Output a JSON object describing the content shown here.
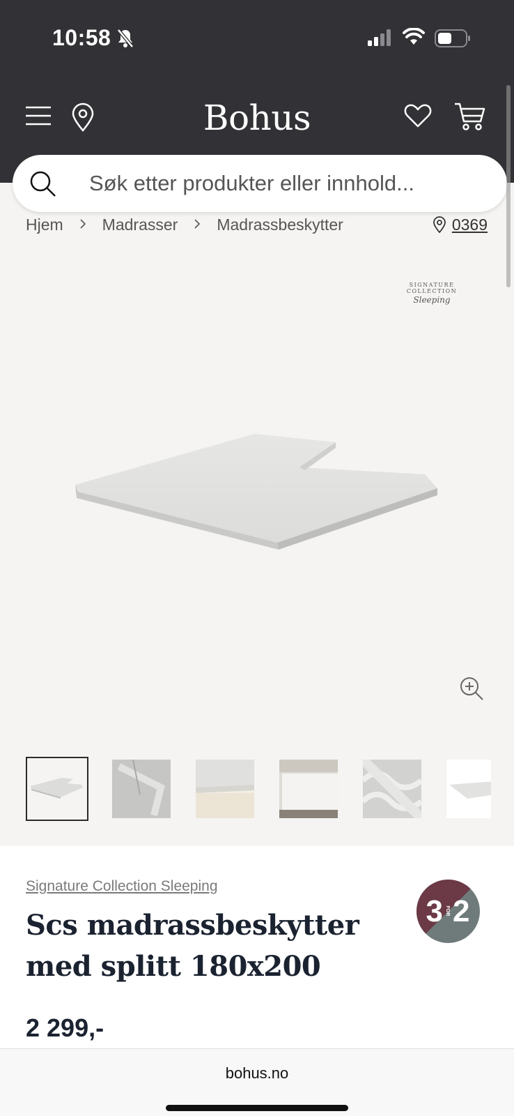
{
  "status": {
    "time": "10:58"
  },
  "header": {
    "logo": "Bohus"
  },
  "search": {
    "placeholder": "Søk etter produkter eller innhold..."
  },
  "breadcrumb": [
    "Hjem",
    "Madrasser",
    "Madrassbeskytter"
  ],
  "store": {
    "code": "0369"
  },
  "brand_badge": {
    "line1": "SIGNATURE COLLECTION",
    "line2": "Sleeping"
  },
  "product": {
    "brand": "Signature Collection Sleeping",
    "title": "Scs madrassbeskytter med splitt 180x200",
    "price": "2 299,-",
    "promo_badge": {
      "left": "3",
      "middle": "FOR",
      "right": "2",
      "colors": [
        "#6b3a46",
        "#6f7b7a"
      ]
    }
  },
  "thumbnails": [
    "product-front",
    "product-detail-zip",
    "product-edge-fleece",
    "product-on-bed",
    "product-quilted-closeup",
    "product-side"
  ],
  "browser": {
    "url": "bohus.no"
  },
  "colors": {
    "header_bg": "#323236",
    "page_bg": "#f5f4f2",
    "title": "#1b2230"
  }
}
